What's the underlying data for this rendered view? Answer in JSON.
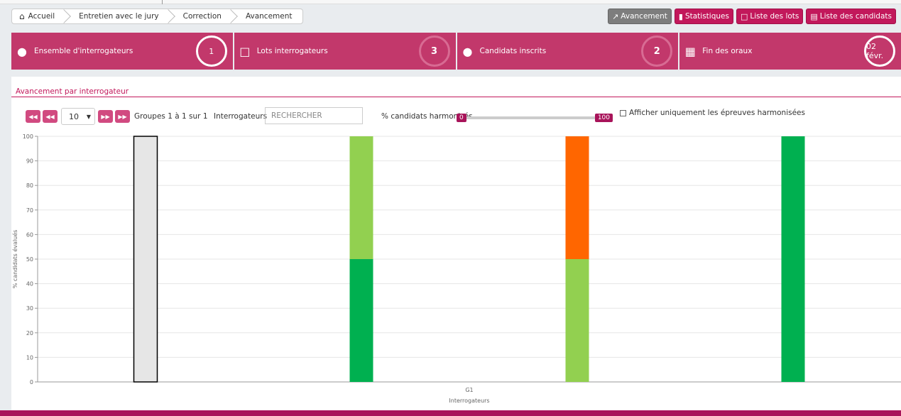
{
  "breadcrumb": [
    "Accueil",
    "Entretien avec le jury",
    "Correction",
    "Avancement"
  ],
  "top_buttons": [
    {
      "label": "Avancement",
      "icon": "line-chart-icon",
      "color": "#7d7d7d"
    },
    {
      "label": "Statistiques",
      "icon": "bar-chart-icon",
      "color": "#c2185b"
    },
    {
      "label": "Liste des lots",
      "icon": "folder-icon",
      "color": "#c2185b"
    },
    {
      "label": "Liste des candidats",
      "icon": "document-icon",
      "color": "#c2185b"
    }
  ],
  "cards": [
    {
      "label": "Ensemble d'interrogateurs",
      "value": "1",
      "icon": "users-icon"
    },
    {
      "label": "Lots interrogateurs",
      "value": "3",
      "icon": "folder-icon"
    },
    {
      "label": "Candidats inscrits",
      "value": "2",
      "icon": "users-icon"
    },
    {
      "label": "Fin des oraux",
      "value": "02 févr.",
      "icon": "calendar-icon"
    }
  ],
  "panel": {
    "title": "Avancement par interrogateur",
    "page_size": "10",
    "groups_text": "Groupes 1 à 1 sur 1",
    "interrogateurs_label": "Interrogateurs",
    "search_placeholder": "RECHERCHER",
    "harmonise_label": "% candidats harmonisés",
    "slider_min": "0",
    "slider_max": "100",
    "checkbox_label": "Afficher uniquement les épreuves harmonisées"
  },
  "colors": {
    "primary": "#c2185b",
    "dark_green": "#00b050",
    "light_green": "#92d050",
    "orange": "#ff6600",
    "gray": "#e6e6e6"
  },
  "chart_data": {
    "type": "bar",
    "stacked": true,
    "categories": [
      "G1"
    ],
    "xlabel": "Interrogateurs",
    "ylabel": "% candidats évalués",
    "ylim": [
      0,
      100
    ],
    "yticks": [
      0,
      10,
      20,
      30,
      40,
      50,
      60,
      70,
      80,
      90,
      100
    ],
    "grid": true,
    "bars": [
      {
        "segments": [
          {
            "value": 100,
            "color": "#e6e6e6",
            "outline": "#000000"
          }
        ]
      },
      {
        "segments": [
          {
            "value": 50,
            "color": "#00b050"
          },
          {
            "value": 50,
            "color": "#92d050"
          }
        ]
      },
      {
        "segments": [
          {
            "value": 50,
            "color": "#92d050"
          },
          {
            "value": 50,
            "color": "#ff6600"
          }
        ]
      },
      {
        "segments": [
          {
            "value": 100,
            "color": "#00b050"
          }
        ]
      }
    ]
  },
  "footer": {
    "color": "#a8145a"
  }
}
